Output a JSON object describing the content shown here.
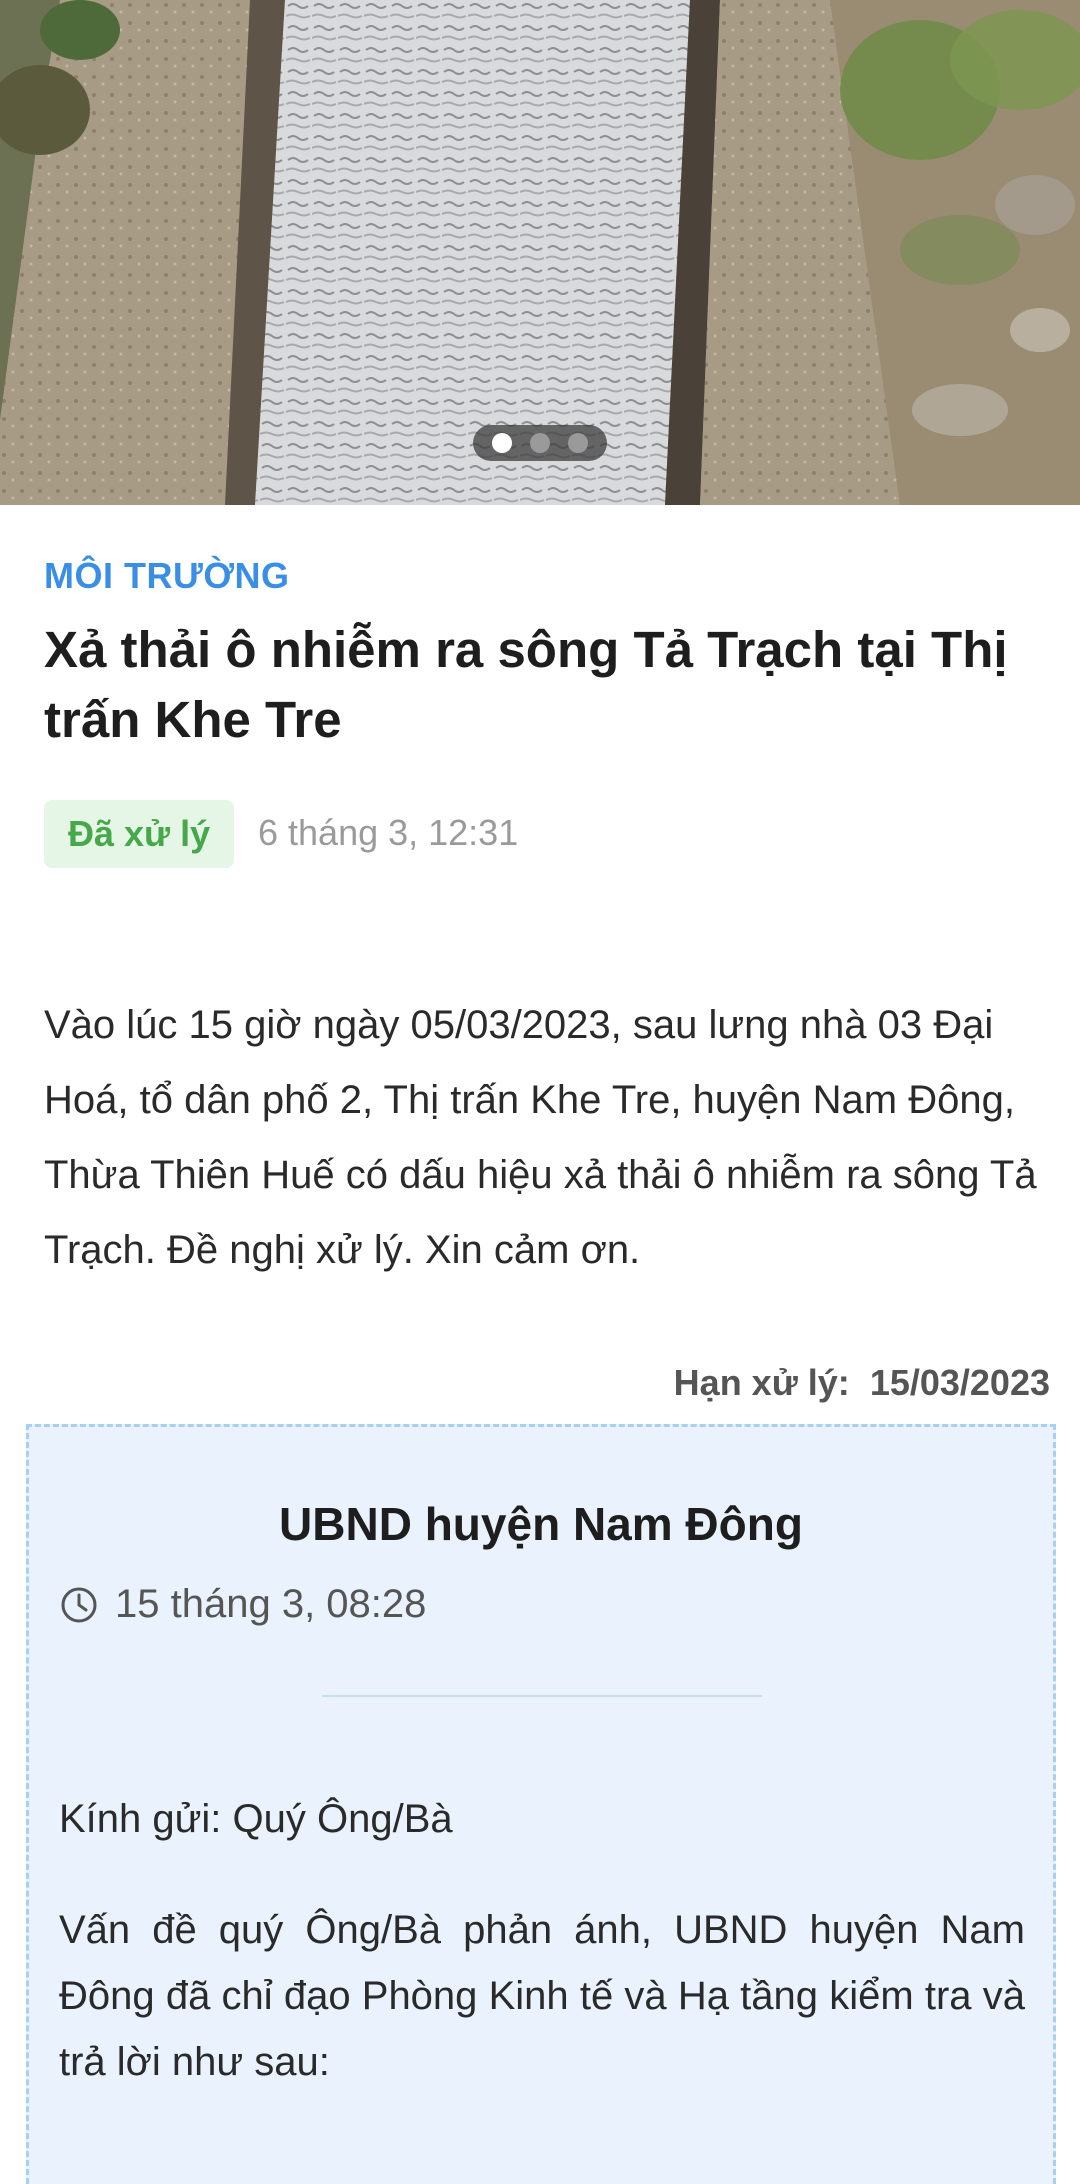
{
  "hero": {
    "slide_count": 3,
    "active_slide": 1
  },
  "article": {
    "category": "MÔI TRƯỜNG",
    "title": "Xả thải ô nhiễm ra sông Tả Trạch tại Thị trấn Khe Tre",
    "status": "Đã xử lý",
    "posted_at": "6 tháng 3, 12:31",
    "body": "Vào lúc 15 giờ ngày 05/03/2023, sau lưng nhà 03 Đại Hoá, tổ dân phố 2, Thị trấn Khe Tre, huyện Nam Đông, Thừa Thiên Huế có dấu hiệu xả thải ô nhiễm ra sông Tả Trạch. Đề nghị xử lý. Xin cảm ơn.",
    "deadline_label": "Hạn xử lý:",
    "deadline_value": "15/03/2023"
  },
  "reply": {
    "organization": "UBND huyện Nam Đông",
    "time_icon": "clock-icon",
    "time": "15 tháng 3, 08:28",
    "greeting": "Kính gửi: Quý Ông/Bà",
    "body": " Vấn đề quý Ông/Bà phản ánh, UBND huyện Nam Đông đã chỉ đạo Phòng Kinh tế và Hạ tầng kiểm tra và trả lời như sau:"
  },
  "colors": {
    "category": "#3a8ee6",
    "status_text": "#46a84a",
    "status_bg": "#e6f6e6",
    "reply_bg": "#e9f2fd",
    "reply_border": "#a9cff1"
  }
}
